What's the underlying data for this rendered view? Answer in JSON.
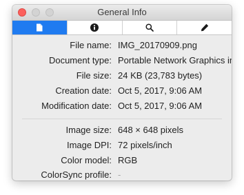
{
  "window": {
    "title": "General Info"
  },
  "toolbar": {
    "tabs": [
      {
        "icon": "document-icon",
        "active": true
      },
      {
        "icon": "info-icon",
        "active": false
      },
      {
        "icon": "magnifier-icon",
        "active": false
      },
      {
        "icon": "pencil-icon",
        "active": false
      }
    ],
    "active_color": "#1f7bf0"
  },
  "file_info": [
    {
      "label": "File name:",
      "value": "IMG_20170909.png"
    },
    {
      "label": "Document type:",
      "value": "Portable Network Graphics image"
    },
    {
      "label": "File size:",
      "value": "24 KB (23,783 bytes)"
    },
    {
      "label": "Creation date:",
      "value": "Oct 5, 2017, 9:06 AM"
    },
    {
      "label": "Modification date:",
      "value": "Oct 5, 2017, 9:06 AM"
    }
  ],
  "image_info": [
    {
      "label": "Image size:",
      "value": "648 × 648 pixels"
    },
    {
      "label": "Image DPI:",
      "value": "72 pixels/inch"
    },
    {
      "label": "Color model:",
      "value": "RGB"
    },
    {
      "label": "ColorSync profile:",
      "value": "-"
    }
  ]
}
